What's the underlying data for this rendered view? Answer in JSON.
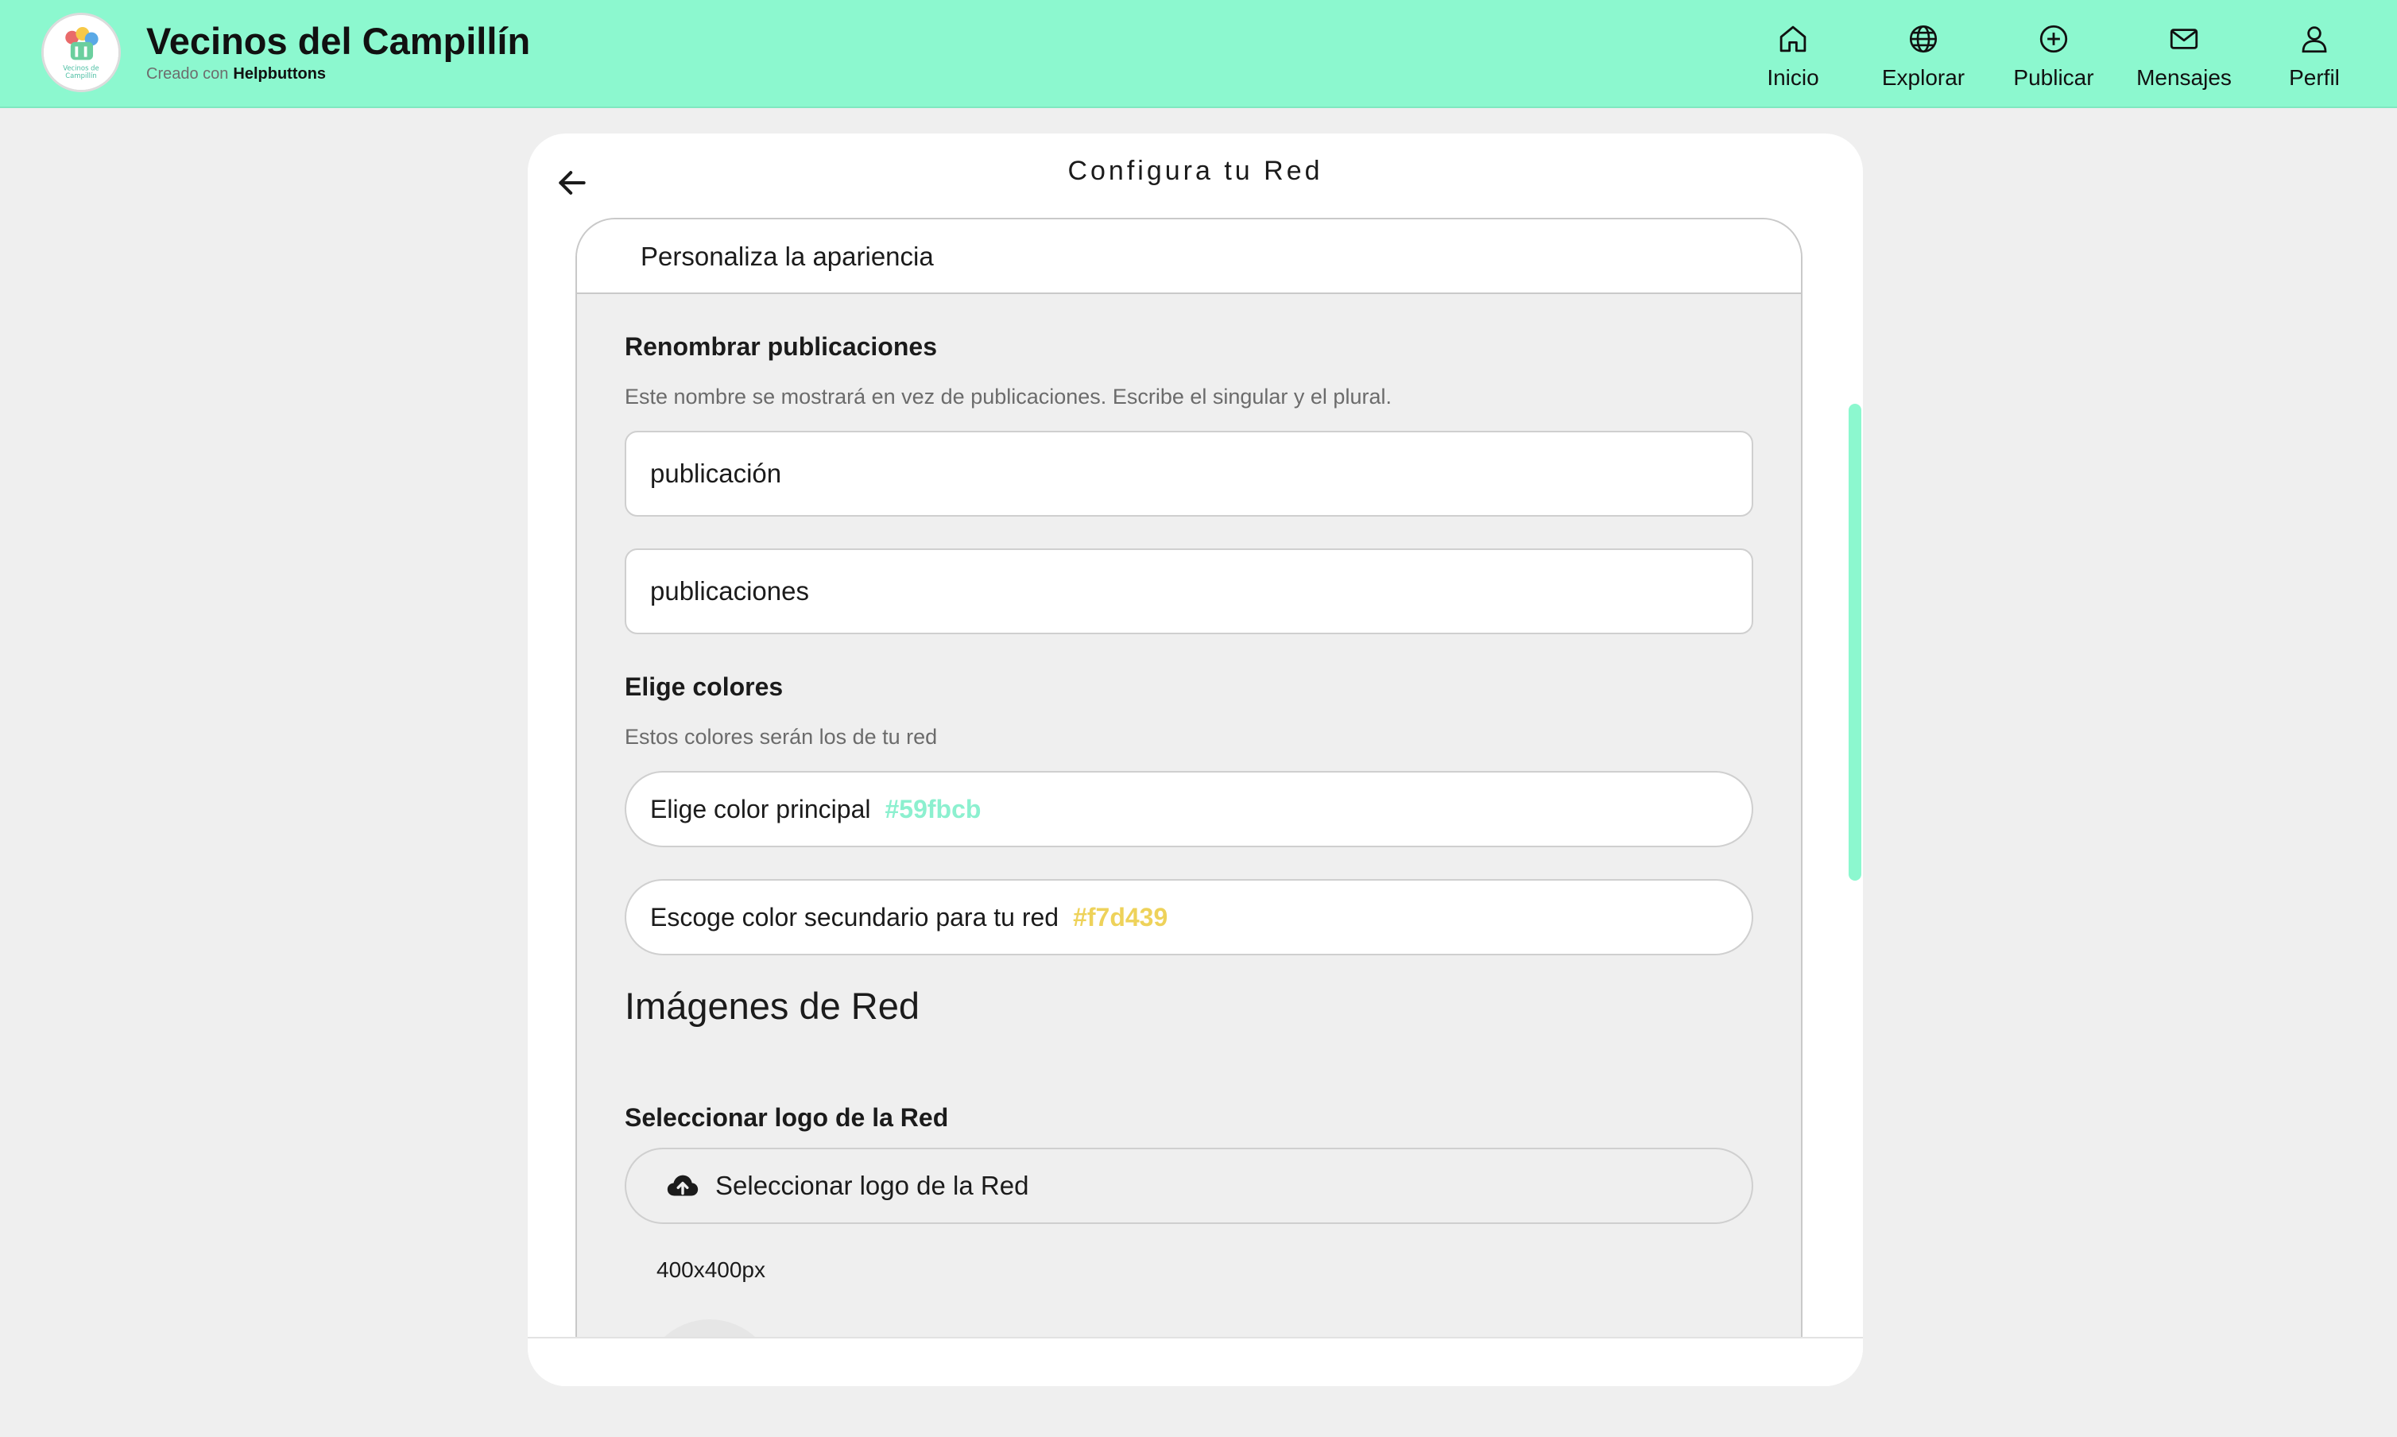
{
  "header": {
    "title": "Vecinos del Campillín",
    "created_with": "Creado con",
    "brand": "Helpbuttons",
    "logo_text": "Vecinos de Campillín"
  },
  "nav": [
    {
      "label": "Inicio",
      "icon": "home-icon"
    },
    {
      "label": "Explorar",
      "icon": "globe-icon"
    },
    {
      "label": "Publicar",
      "icon": "plus-circle-icon"
    },
    {
      "label": "Mensajes",
      "icon": "envelope-icon"
    },
    {
      "label": "Perfil",
      "icon": "user-icon"
    }
  ],
  "page": {
    "title": "Configura tu Red",
    "section_title": "Personaliza la apariencia"
  },
  "rename": {
    "label": "Renombrar publicaciones",
    "help": "Este nombre se mostrará en vez de publicaciones. Escribe el singular y el plural.",
    "singular_value": "publicación",
    "plural_value": "publicaciones"
  },
  "colors": {
    "label": "Elige colores",
    "help": "Estos colores serán los de tu red",
    "primary_label": "Elige color principal",
    "primary_value": "#59fbcb",
    "secondary_label": "Escoge color secundario para tu red",
    "secondary_value": "#f7d439"
  },
  "images": {
    "title": "Imágenes de Red",
    "logo_label": "Seleccionar logo de la Red",
    "logo_button": "Seleccionar logo de la Red",
    "logo_size": "400x400px"
  },
  "theme": {
    "header_bg": "#8cf8cf",
    "accent": "#8cf8cf",
    "primary_color": "#59fbcb",
    "secondary_color": "#f7d439"
  }
}
